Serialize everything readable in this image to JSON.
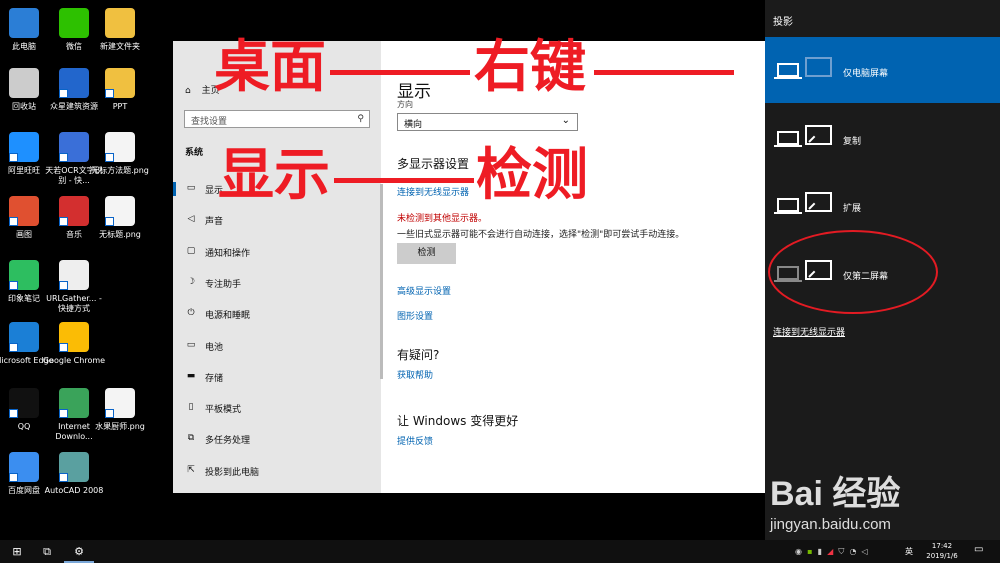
{
  "desktop": {
    "icons": [
      {
        "label": "此电脑",
        "icon": "computer-icon",
        "color": "#2b7ed6"
      },
      {
        "label": "微信",
        "icon": "wechat-icon",
        "color": "#2dc100"
      },
      {
        "label": "新建文件夹",
        "icon": "folder-icon",
        "color": "#f0c040"
      },
      {
        "label": "回收站",
        "icon": "recycle-bin-icon",
        "color": "#cccccc"
      },
      {
        "label": "众星建筑资源",
        "icon": "app-icon",
        "color": "#2266cc"
      },
      {
        "label": "PPT",
        "icon": "folder-icon",
        "color": "#f0c040"
      },
      {
        "label": "阿里旺旺",
        "icon": "aliwangwang-icon",
        "color": "#1e90ff"
      },
      {
        "label": "天若OCR文字识别 - 快...",
        "icon": "ocr-app-icon",
        "color": "#3a6fd8"
      },
      {
        "label": "无标方法题.png",
        "icon": "image-file-icon",
        "color": "#f4f4f4"
      },
      {
        "label": "画图",
        "icon": "paint-icon",
        "color": "#e05030"
      },
      {
        "label": "音乐",
        "icon": "netease-music-icon",
        "color": "#d32f2f"
      },
      {
        "label": "无标题.png",
        "icon": "image-file-icon",
        "color": "#f4f4f4"
      },
      {
        "label": "印象笔记",
        "icon": "evernote-icon",
        "color": "#2dbe60"
      },
      {
        "label": "URLGather... - 快捷方式",
        "icon": "globe-icon",
        "color": "#eeeeee"
      },
      {
        "label": "Microsoft Edge",
        "icon": "edge-icon",
        "color": "#1b7fd6"
      },
      {
        "label": "Google Chrome",
        "icon": "chrome-icon",
        "color": "#fbbc05"
      },
      {
        "label": "QQ",
        "icon": "qq-icon",
        "color": "#111111"
      },
      {
        "label": "Internet Downlo...",
        "icon": "idm-icon",
        "color": "#3aa35a"
      },
      {
        "label": "水果厨师.png",
        "icon": "image-file-icon",
        "color": "#f4f4f4"
      },
      {
        "label": "百度网盘",
        "icon": "baidu-netdisk-icon",
        "color": "#3b8ef0"
      },
      {
        "label": "AutoCAD 2008",
        "icon": "autocad-icon",
        "color": "#5aa0a0"
      }
    ]
  },
  "settings": {
    "window_title": "设置",
    "home_label": "主页",
    "search_placeholder": "查找设置",
    "section_label": "系统",
    "nav": [
      {
        "label": "显示",
        "icon": "display-icon"
      },
      {
        "label": "声音",
        "icon": "speaker-icon"
      },
      {
        "label": "通知和操作",
        "icon": "notification-icon"
      },
      {
        "label": "专注助手",
        "icon": "moon-icon"
      },
      {
        "label": "电源和睡眠",
        "icon": "power-icon"
      },
      {
        "label": "电池",
        "icon": "battery-icon"
      },
      {
        "label": "存储",
        "icon": "storage-icon"
      },
      {
        "label": "平板模式",
        "icon": "tablet-icon"
      },
      {
        "label": "多任务处理",
        "icon": "multitask-icon"
      },
      {
        "label": "投影到此电脑",
        "icon": "project-icon"
      }
    ],
    "main": {
      "title": "显示",
      "orientation_label": "方向",
      "orientation_value": "横向",
      "multi_display_heading": "多显示器设置",
      "connect_wireless_link": "连接到无线显示器",
      "not_detected": "未检测到其他显示器。",
      "description": "一些旧式显示器可能不会进行自动连接，选择\"检测\"即可尝试手动连接。",
      "detect_button": "检测",
      "advanced_link": "高级显示设置",
      "graphics_link": "图形设置",
      "question_heading": "有疑问?",
      "help_link": "获取帮助",
      "improve_heading": "让 Windows 变得更好",
      "feedback_link": "提供反馈"
    }
  },
  "annotation": {
    "line1_a": "桌面",
    "line1_b": "右键",
    "line2_a": "显示",
    "line2_b": "检测",
    "color": "#ee1c24"
  },
  "project_panel": {
    "title": "投影",
    "options": [
      {
        "label": "仅电脑屏幕",
        "selected": true
      },
      {
        "label": "复制",
        "selected": false
      },
      {
        "label": "扩展",
        "selected": false
      },
      {
        "label": "仅第二屏幕",
        "selected": false
      }
    ],
    "wireless_link": "连接到无线显示器",
    "accent": "#0063b1"
  },
  "watermark": {
    "brand": "Bai 经验",
    "url": "jingyan.baidu.com"
  },
  "taskbar": {
    "ime": "英",
    "time": "17:42",
    "date": "2019/1/6"
  }
}
